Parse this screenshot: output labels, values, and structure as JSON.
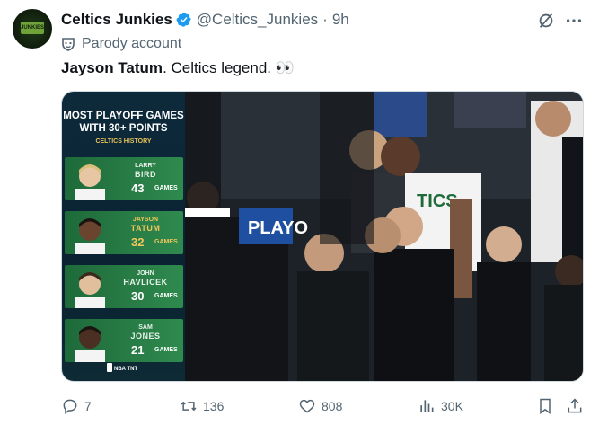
{
  "author": {
    "name": "Celtics Junkies",
    "handle": "@Celtics_Junkies",
    "time": "9h",
    "separator": "·",
    "label": "Parody account",
    "avatar_text": "JUNKIES"
  },
  "tweet": {
    "bold": "Jayson Tatum",
    "rest": ". Celtics legend. 👀"
  },
  "graphic": {
    "title_line1": "MOST PLAYOFF GAMES",
    "title_line2": "WITH 30+ POINTS",
    "subtitle": "CELTICS HISTORY",
    "unit": "GAMES",
    "players": [
      {
        "first": "LARRY",
        "last": "BIRD",
        "games": 43,
        "highlight": false
      },
      {
        "first": "JAYSON",
        "last": "TATUM",
        "games": 32,
        "highlight": true
      },
      {
        "first": "JOHN",
        "last": "HAVLICEK",
        "games": 30,
        "highlight": false
      },
      {
        "first": "SAM",
        "last": "JONES",
        "games": 21,
        "highlight": false
      }
    ],
    "logos": "NBA TNT"
  },
  "photo": {
    "jersey_text": "TICS",
    "board_text": "PLAYO"
  },
  "actions": {
    "replies": "7",
    "reposts": "136",
    "likes": "808",
    "views": "30K"
  },
  "colors": {
    "link_gray": "#536471",
    "verified_blue": "#1d9bf0",
    "card_green": "#2f8a4e",
    "highlight_gold": "#f2c75c"
  }
}
